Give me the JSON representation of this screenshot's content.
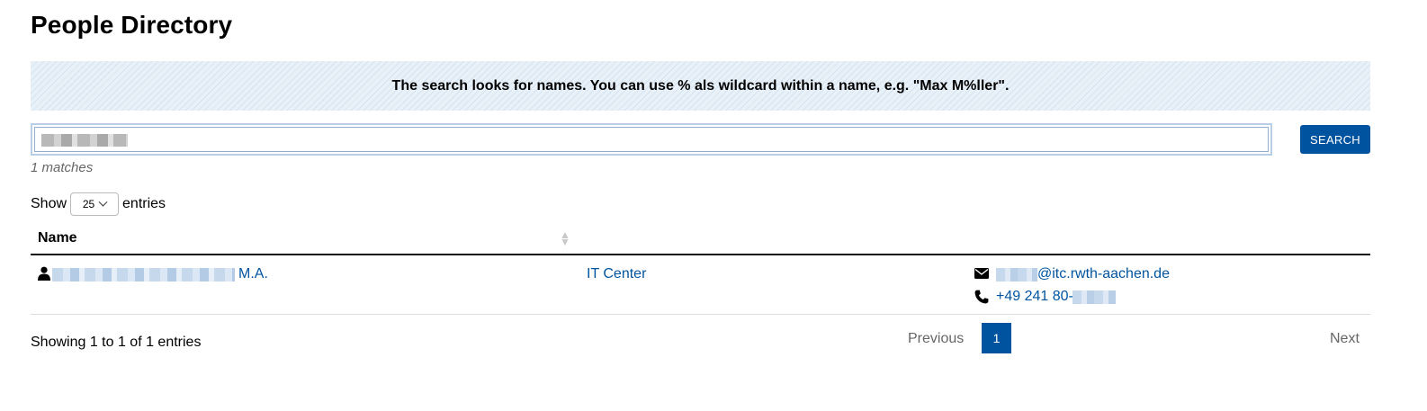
{
  "page": {
    "title": "People Directory"
  },
  "notice": {
    "text": "The search looks for names. You can use % als wildcard within a name, e.g. \"Max M%ller\"."
  },
  "search": {
    "value": "",
    "button_label": "SEARCH"
  },
  "results": {
    "matches_text": "1 matches"
  },
  "length_menu": {
    "prefix": "Show",
    "selected": "25",
    "suffix": "entries"
  },
  "table": {
    "headers": [
      "Name",
      "",
      ""
    ],
    "rows": [
      {
        "name_suffix": "M.A.",
        "department": "IT Center",
        "email_domain": "@itc.rwth-aachen.de",
        "phone_prefix": "+49 241 80-",
        "icons": {
          "person": "person-icon",
          "mail": "envelope-icon",
          "phone": "phone-icon"
        }
      }
    ]
  },
  "footer": {
    "info": "Showing 1 to 1 of 1 entries",
    "previous_label": "Previous",
    "current_page": "1",
    "next_label": "Next"
  },
  "colors": {
    "accent": "#00549f",
    "notice_bg": "#e8f0f8"
  }
}
